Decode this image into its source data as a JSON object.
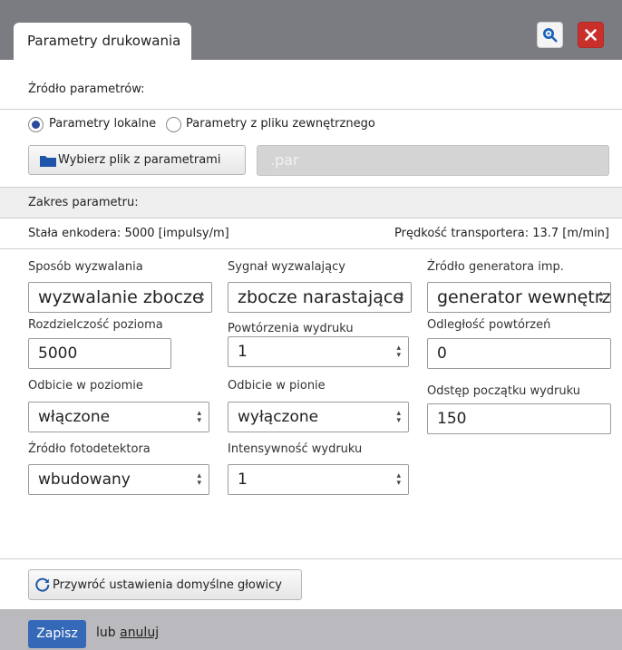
{
  "window": {
    "title": "Parametry drukowania"
  },
  "source_section": {
    "heading": "Źródło parametrów:"
  },
  "radio_options": {
    "local": "Parametry lokalne",
    "external": "Parametry z pliku zewnętrznego",
    "selected": "local"
  },
  "file_button": {
    "label": "Wybierz plik z parametrami"
  },
  "file_field": {
    "placeholder": ".par",
    "value": ""
  },
  "range_section": {
    "heading": "Zakres parametru:"
  },
  "info": {
    "encoder": "Stała enkodera: 5000 [impulsy/m]",
    "speed": "Prędkość transportera: 13.7 [m/min]"
  },
  "fields": [
    {
      "label": "Sposób wyzwalania",
      "value": "wyzwalanie zbocze"
    },
    {
      "label": "Sygnał wyzwalający",
      "value": "zbocze narastające"
    },
    {
      "label": "Źródło generatora imp.",
      "value": "generator wewnętrz"
    },
    {
      "label": "Rozdzielczość pozioma",
      "value": "5000"
    },
    {
      "label": "Powtórzenia wydruku",
      "value": "1"
    },
    {
      "label": "Odległość powtórzeń",
      "value": "0"
    },
    {
      "label": "Odbicie w poziomie",
      "value": "włączone"
    },
    {
      "label": "Odbicie w pionie",
      "value": "wyłączone"
    },
    {
      "label": "Odstęp początku wydruku",
      "value": "150"
    },
    {
      "label": "Źródło fotodetektora",
      "value": "wbudowany"
    },
    {
      "label": "Intensywność wydruku",
      "value": "1"
    }
  ],
  "reset_button": {
    "label": "Przywróć ustawienia domyślne głowicy"
  },
  "footer": {
    "save": "Zapisz",
    "or": "lub",
    "cancel": "anuluj"
  },
  "colors": {
    "titlebar": "#7b7b82",
    "close": "#c9302c",
    "save": "#3569b8",
    "footer": "#b9b9be"
  }
}
